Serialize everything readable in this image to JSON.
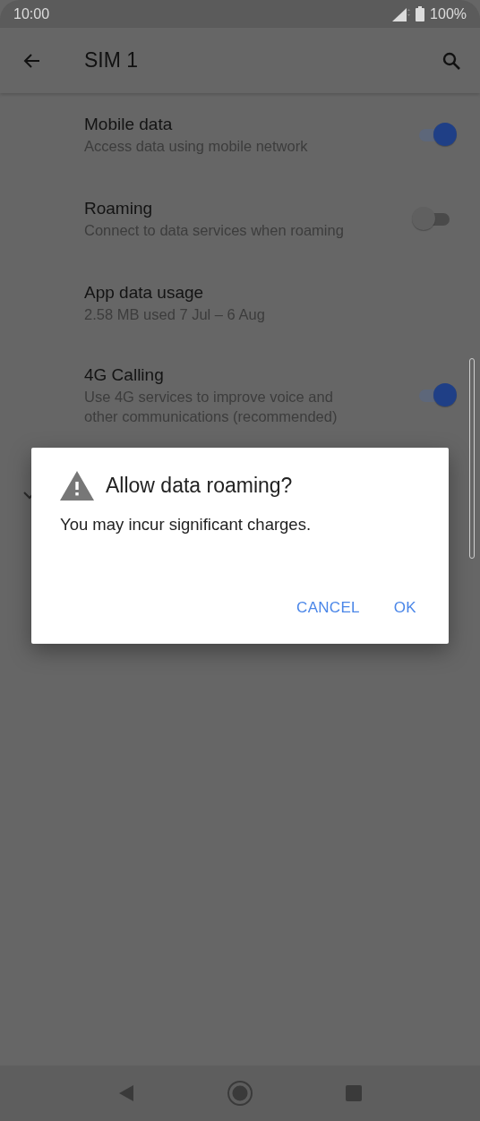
{
  "status_bar": {
    "time": "10:00",
    "battery": "100%"
  },
  "app_bar": {
    "title": "SIM 1"
  },
  "settings": [
    {
      "kind": "toggle",
      "title": "Mobile data",
      "subtitle": "Access data using mobile network",
      "on": true
    },
    {
      "kind": "toggle",
      "title": "Roaming",
      "subtitle": "Connect to data services when roaming",
      "on": false
    },
    {
      "kind": "link",
      "title": "App data usage",
      "subtitle": "2.58 MB used 7 Jul – 6 Aug"
    },
    {
      "kind": "toggle",
      "title": "4G Calling",
      "subtitle": "Use 4G services to improve voice and other communications (recommended)",
      "on": true
    },
    {
      "kind": "expander"
    }
  ],
  "dialog": {
    "title": "Allow data roaming?",
    "message": "You may incur significant charges.",
    "buttons": [
      "CANCEL",
      "OK"
    ]
  }
}
